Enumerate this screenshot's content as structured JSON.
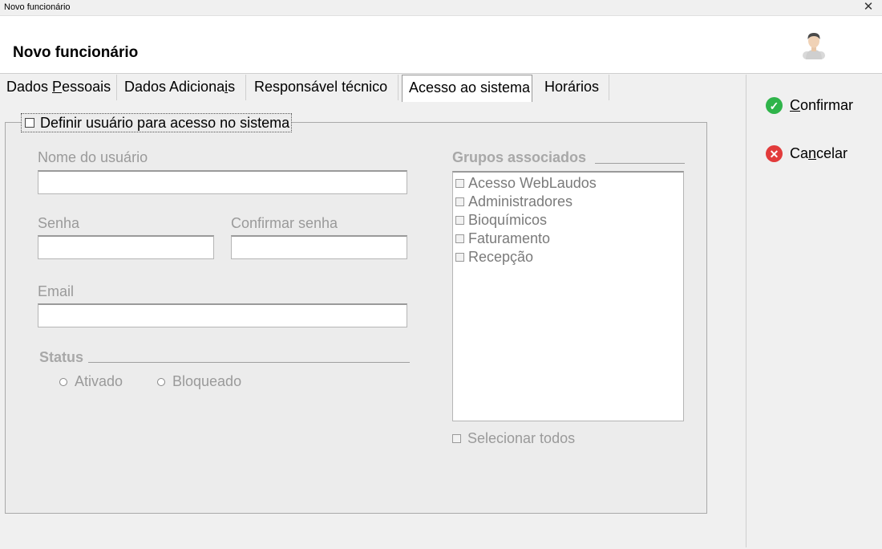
{
  "window": {
    "title": "Novo funcionário",
    "close_glyph": "✕"
  },
  "header": {
    "heading": "Novo funcionário",
    "avatar_icon": "user-avatar-icon"
  },
  "tabs": [
    {
      "label_pre": "Dados ",
      "label_ul": "P",
      "label_post": "essoais"
    },
    {
      "label_pre": "Dados Adiciona",
      "label_ul": "i",
      "label_post": "s"
    },
    {
      "label_pre": "Responsável técnico",
      "label_ul": "",
      "label_post": ""
    },
    {
      "label_pre": "Acesso ao sistema",
      "label_ul": "",
      "label_post": ""
    },
    {
      "label_pre": "Horários",
      "label_ul": "",
      "label_post": ""
    }
  ],
  "active_tab": "Acesso ao sistema",
  "access": {
    "define_user_label": "Definir usuário para acesso no sistema",
    "define_user_checked": false,
    "username_label": "Nome do usuário",
    "username_value": "",
    "password_label": "Senha",
    "password_value": "",
    "confirm_password_label": "Confirmar senha",
    "confirm_password_value": "",
    "email_label": "Email",
    "email_value": "",
    "status_title": "Status",
    "status_options": [
      "Ativado",
      "Bloqueado"
    ],
    "groups_title": "Grupos associados",
    "groups": [
      "Acesso WebLaudos",
      "Administradores",
      "Bioquímicos",
      "Faturamento",
      "Recepção"
    ],
    "select_all_label": "Selecionar todos"
  },
  "actions": {
    "confirm_pre": "",
    "confirm_ul": "C",
    "confirm_post": "onfirmar",
    "cancel_pre": "Ca",
    "cancel_ul": "n",
    "cancel_post": "celar"
  },
  "colors": {
    "confirm_icon": "#2fb44a",
    "cancel_icon": "#e23b3b"
  }
}
